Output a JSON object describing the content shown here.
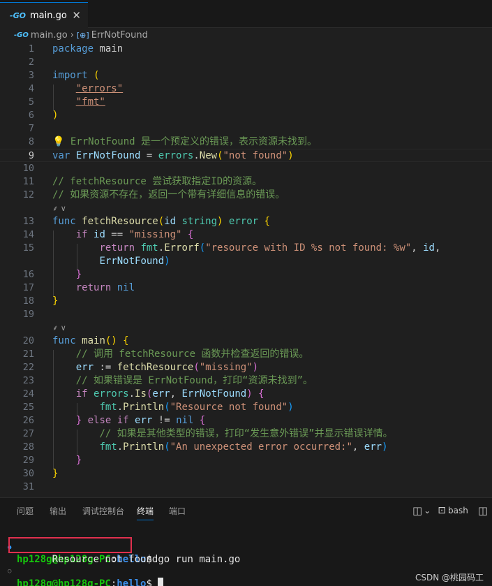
{
  "tab": {
    "title": "main.go",
    "close": "✕",
    "icon": "-GO"
  },
  "breadcrumb": {
    "file": "main.go",
    "symbol": "ErrNotFound",
    "sep": "›",
    "file_icon": "-GO",
    "symbol_icon": "[⊕]"
  },
  "editor": {
    "active_line": 9,
    "lines": [
      {
        "n": "1",
        "tokens": [
          [
            "kw",
            "package"
          ],
          [
            "pl",
            " main"
          ]
        ]
      },
      {
        "n": "2",
        "tokens": []
      },
      {
        "n": "3",
        "tokens": [
          [
            "kw",
            "import"
          ],
          [
            "pl",
            " "
          ],
          [
            "par1",
            "("
          ]
        ]
      },
      {
        "n": "4",
        "tokens": [
          [
            "pl",
            "    "
          ],
          [
            "strul",
            "\"errors\""
          ]
        ]
      },
      {
        "n": "5",
        "tokens": [
          [
            "pl",
            "    "
          ],
          [
            "strul",
            "\"fmt\""
          ]
        ]
      },
      {
        "n": "6",
        "tokens": [
          [
            "par1",
            ")"
          ]
        ]
      },
      {
        "n": "7",
        "tokens": []
      },
      {
        "n": "8",
        "tokens": [
          [
            "bulb",
            "💡"
          ],
          [
            "cmt",
            " ErrNotFound 是一个预定义的错误，表示资源未找到。"
          ]
        ]
      },
      {
        "n": "9",
        "tokens": [
          [
            "kw",
            "var"
          ],
          [
            "pl",
            " "
          ],
          [
            "var",
            "ErrNotFound"
          ],
          [
            "pl",
            " = "
          ],
          [
            "typ",
            "errors"
          ],
          [
            "pl",
            "."
          ],
          [
            "fn",
            "New"
          ],
          [
            "par1",
            "("
          ],
          [
            "str",
            "\"not found\""
          ],
          [
            "par1",
            ")"
          ]
        ]
      },
      {
        "n": "10",
        "tokens": []
      },
      {
        "n": "11",
        "tokens": [
          [
            "cmt",
            "// fetchResource 尝试获取指定ID的资源。"
          ]
        ]
      },
      {
        "n": "12",
        "tokens": [
          [
            "cmt",
            "// 如果资源不存在，返回一个带有详细信息的错误。"
          ]
        ]
      },
      {
        "n": "",
        "lens": "⸙ ∨"
      },
      {
        "n": "13",
        "tokens": [
          [
            "kw",
            "func"
          ],
          [
            "pl",
            " "
          ],
          [
            "fn",
            "fetchResource"
          ],
          [
            "par1",
            "("
          ],
          [
            "var",
            "id"
          ],
          [
            "pl",
            " "
          ],
          [
            "typ",
            "string"
          ],
          [
            "par1",
            ")"
          ],
          [
            "pl",
            " "
          ],
          [
            "typ",
            "error"
          ],
          [
            "pl",
            " "
          ],
          [
            "par1",
            "{"
          ]
        ]
      },
      {
        "n": "14",
        "tokens": [
          [
            "pl",
            "    "
          ],
          [
            "ctl",
            "if"
          ],
          [
            "pl",
            " "
          ],
          [
            "var",
            "id"
          ],
          [
            "pl",
            " == "
          ],
          [
            "str",
            "\"missing\""
          ],
          [
            "pl",
            " "
          ],
          [
            "par2",
            "{"
          ]
        ]
      },
      {
        "n": "15",
        "tokens": [
          [
            "pl",
            "        "
          ],
          [
            "ctl",
            "return"
          ],
          [
            "pl",
            " "
          ],
          [
            "typ",
            "fmt"
          ],
          [
            "pl",
            "."
          ],
          [
            "fn",
            "Errorf"
          ],
          [
            "par3",
            "("
          ],
          [
            "str",
            "\"resource with ID %s not found: %w\""
          ],
          [
            "pl",
            ", "
          ],
          [
            "var",
            "id"
          ],
          [
            "pl",
            ","
          ]
        ]
      },
      {
        "n": "",
        "tokens": [
          [
            "pl",
            "        "
          ],
          [
            "var",
            "ErrNotFound"
          ],
          [
            "par3",
            ")"
          ]
        ]
      },
      {
        "n": "16",
        "tokens": [
          [
            "pl",
            "    "
          ],
          [
            "par2",
            "}"
          ]
        ]
      },
      {
        "n": "17",
        "tokens": [
          [
            "pl",
            "    "
          ],
          [
            "ctl",
            "return"
          ],
          [
            "pl",
            " "
          ],
          [
            "kw",
            "nil"
          ]
        ]
      },
      {
        "n": "18",
        "tokens": [
          [
            "par1",
            "}"
          ]
        ]
      },
      {
        "n": "19",
        "tokens": []
      },
      {
        "n": "",
        "lens": "⸙ ∨"
      },
      {
        "n": "20",
        "tokens": [
          [
            "kw",
            "func"
          ],
          [
            "pl",
            " "
          ],
          [
            "fn",
            "main"
          ],
          [
            "par1",
            "()"
          ],
          [
            "pl",
            " "
          ],
          [
            "par1",
            "{"
          ]
        ]
      },
      {
        "n": "21",
        "tokens": [
          [
            "pl",
            "    "
          ],
          [
            "cmt",
            "// 调用 fetchResource 函数并检查返回的错误。"
          ]
        ]
      },
      {
        "n": "22",
        "tokens": [
          [
            "pl",
            "    "
          ],
          [
            "var",
            "err"
          ],
          [
            "pl",
            " := "
          ],
          [
            "fn",
            "fetchResource"
          ],
          [
            "par2",
            "("
          ],
          [
            "str",
            "\"missing\""
          ],
          [
            "par2",
            ")"
          ]
        ]
      },
      {
        "n": "23",
        "tokens": [
          [
            "pl",
            "    "
          ],
          [
            "cmt",
            "// 如果错误是 ErrNotFound，打印“资源未找到”。"
          ]
        ]
      },
      {
        "n": "24",
        "tokens": [
          [
            "pl",
            "    "
          ],
          [
            "ctl",
            "if"
          ],
          [
            "pl",
            " "
          ],
          [
            "typ",
            "errors"
          ],
          [
            "pl",
            "."
          ],
          [
            "fn",
            "Is"
          ],
          [
            "par2",
            "("
          ],
          [
            "var",
            "err"
          ],
          [
            "pl",
            ", "
          ],
          [
            "var",
            "ErrNotFound"
          ],
          [
            "par2",
            ")"
          ],
          [
            "pl",
            " "
          ],
          [
            "par2",
            "{"
          ]
        ]
      },
      {
        "n": "25",
        "tokens": [
          [
            "pl",
            "        "
          ],
          [
            "typ",
            "fmt"
          ],
          [
            "pl",
            "."
          ],
          [
            "fn",
            "Println"
          ],
          [
            "par3",
            "("
          ],
          [
            "str",
            "\"Resource not found\""
          ],
          [
            "par3",
            ")"
          ]
        ]
      },
      {
        "n": "26",
        "tokens": [
          [
            "pl",
            "    "
          ],
          [
            "par2",
            "}"
          ],
          [
            "pl",
            " "
          ],
          [
            "ctl",
            "else"
          ],
          [
            "pl",
            " "
          ],
          [
            "ctl",
            "if"
          ],
          [
            "pl",
            " "
          ],
          [
            "var",
            "err"
          ],
          [
            "pl",
            " != "
          ],
          [
            "kw",
            "nil"
          ],
          [
            "pl",
            " "
          ],
          [
            "par2",
            "{"
          ]
        ]
      },
      {
        "n": "27",
        "tokens": [
          [
            "pl",
            "        "
          ],
          [
            "cmt",
            "// 如果是其他类型的错误，打印“发生意外错误”并显示错误详情。"
          ]
        ]
      },
      {
        "n": "28",
        "tokens": [
          [
            "pl",
            "        "
          ],
          [
            "typ",
            "fmt"
          ],
          [
            "pl",
            "."
          ],
          [
            "fn",
            "Println"
          ],
          [
            "par3",
            "("
          ],
          [
            "str",
            "\"An unexpected error occurred:\""
          ],
          [
            "pl",
            ", "
          ],
          [
            "var",
            "err"
          ],
          [
            "par3",
            ")"
          ]
        ]
      },
      {
        "n": "29",
        "tokens": [
          [
            "pl",
            "    "
          ],
          [
            "par2",
            "}"
          ]
        ]
      },
      {
        "n": "30",
        "tokens": [
          [
            "par1",
            "}"
          ]
        ]
      },
      {
        "n": "31",
        "tokens": []
      }
    ]
  },
  "panel": {
    "tabs": [
      "问题",
      "输出",
      "调试控制台",
      "终端",
      "端口"
    ],
    "active_tab": "终端",
    "split_icon": "◫",
    "chevron_icon": "⌄",
    "shell_icon": "⊡",
    "shell": "bash",
    "extra_icon": "◫"
  },
  "terminal": {
    "user": "hp128g@hp128g-PC",
    "colon": ":",
    "path": "hello",
    "prompt": "$ ",
    "command": "go run main.go",
    "output": "Resource not found",
    "dot_filled": "●",
    "dot_hollow": "○"
  },
  "watermark": "CSDN @桃园码工"
}
